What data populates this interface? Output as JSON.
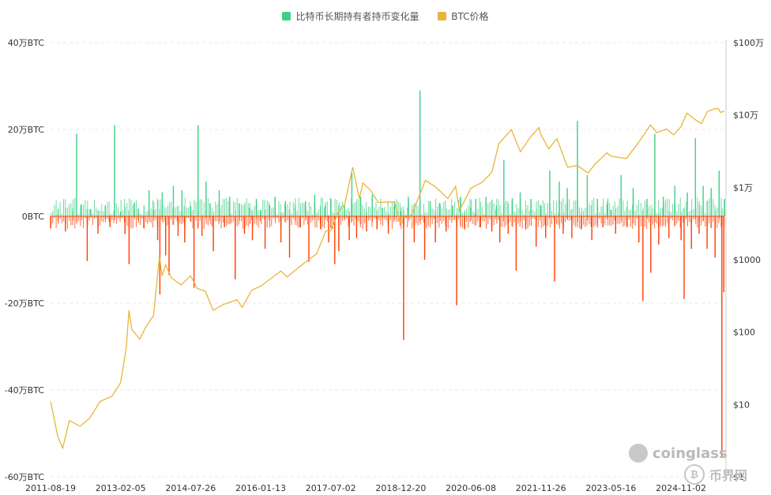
{
  "legend": {
    "lth_label": "比特币长期持有者持币变化量",
    "price_label": "BTC价格",
    "lth_pos_color": "#3fcf86",
    "lth_neg_color": "#ff3d00",
    "price_color": "#e8b53a"
  },
  "watermark": {
    "brand": "coinglass",
    "brand2": "币界网"
  },
  "chart_data": {
    "type": "bar",
    "left_axis": {
      "ticks": [
        "40万BTC",
        "20万BTC",
        "0BTC",
        "-20万BTC",
        "-40万BTC",
        "-60万BTC"
      ],
      "values": [
        400000,
        200000,
        0,
        -200000,
        -400000,
        -600000
      ],
      "ylim": [
        -600000,
        400000
      ]
    },
    "right_axis": {
      "scale": "log",
      "ticks": [
        "$100万",
        "$10万",
        "$1万",
        "$1000",
        "$100",
        "$10",
        "$1"
      ],
      "values": [
        1000000,
        100000,
        10000,
        1000,
        100,
        10,
        1
      ],
      "ylim": [
        1,
        1000000
      ]
    },
    "x_ticks": [
      "2011-08-19",
      "2013-02-05",
      "2014-07-26",
      "2016-01-13",
      "2017-07-02",
      "2018-12-20",
      "2020-06-08",
      "2021-11-26",
      "2023-05-16",
      "2024-11-02"
    ],
    "x_range": [
      "2011-08-19",
      "2025-09-30"
    ],
    "grid": true,
    "legend_position": "top-center",
    "series": [
      {
        "name": "BTC价格",
        "type": "line",
        "axis": "right",
        "points": [
          [
            "2011-08-19",
            11
          ],
          [
            "2011-10-15",
            3.5
          ],
          [
            "2011-11-20",
            2.5
          ],
          [
            "2012-01-10",
            6
          ],
          [
            "2012-04-01",
            5
          ],
          [
            "2012-06-15",
            6.5
          ],
          [
            "2012-09-01",
            11
          ],
          [
            "2012-12-01",
            13
          ],
          [
            "2013-02-05",
            20
          ],
          [
            "2013-03-20",
            60
          ],
          [
            "2013-04-10",
            200
          ],
          [
            "2013-05-01",
            110
          ],
          [
            "2013-07-01",
            80
          ],
          [
            "2013-08-20",
            120
          ],
          [
            "2013-10-15",
            170
          ],
          [
            "2013-11-29",
            1100
          ],
          [
            "2013-12-20",
            600
          ],
          [
            "2014-01-15",
            850
          ],
          [
            "2014-03-01",
            560
          ],
          [
            "2014-05-15",
            450
          ],
          [
            "2014-07-26",
            600
          ],
          [
            "2014-09-15",
            400
          ],
          [
            "2014-11-15",
            370
          ],
          [
            "2015-01-14",
            200
          ],
          [
            "2015-04-01",
            240
          ],
          [
            "2015-07-15",
            280
          ],
          [
            "2015-08-25",
            220
          ],
          [
            "2015-11-05",
            380
          ],
          [
            "2016-01-13",
            430
          ],
          [
            "2016-06-15",
            700
          ],
          [
            "2016-08-01",
            580
          ],
          [
            "2016-12-31",
            960
          ],
          [
            "2017-03-15",
            1200
          ],
          [
            "2017-05-25",
            2500
          ],
          [
            "2017-07-02",
            2500
          ],
          [
            "2017-09-01",
            4700
          ],
          [
            "2017-10-15",
            5700
          ],
          [
            "2017-12-17",
            19000
          ],
          [
            "2018-02-06",
            7000
          ],
          [
            "2018-03-05",
            11500
          ],
          [
            "2018-05-01",
            9200
          ],
          [
            "2018-06-30",
            6200
          ],
          [
            "2018-11-01",
            6300
          ],
          [
            "2018-12-15",
            3200
          ],
          [
            "2018-12-20",
            3900
          ],
          [
            "2019-03-01",
            3800
          ],
          [
            "2019-05-15",
            8000
          ],
          [
            "2019-06-26",
            12500
          ],
          [
            "2019-09-15",
            10000
          ],
          [
            "2019-12-15",
            7000
          ],
          [
            "2020-02-12",
            10300
          ],
          [
            "2020-03-13",
            4800
          ],
          [
            "2020-06-08",
            9700
          ],
          [
            "2020-09-01",
            11700
          ],
          [
            "2020-11-15",
            16000
          ],
          [
            "2021-01-08",
            40000
          ],
          [
            "2021-04-14",
            63000
          ],
          [
            "2021-06-22",
            31000
          ],
          [
            "2021-09-01",
            48000
          ],
          [
            "2021-11-10",
            67000
          ],
          [
            "2021-11-26",
            54000
          ],
          [
            "2022-01-24",
            34000
          ],
          [
            "2022-03-28",
            47000
          ],
          [
            "2022-06-18",
            19000
          ],
          [
            "2022-09-01",
            20000
          ],
          [
            "2022-11-21",
            15800
          ],
          [
            "2023-01-15",
            21000
          ],
          [
            "2023-04-14",
            30000
          ],
          [
            "2023-05-16",
            27000
          ],
          [
            "2023-09-11",
            25000
          ],
          [
            "2023-12-15",
            42000
          ],
          [
            "2024-03-14",
            73000
          ],
          [
            "2024-05-01",
            57000
          ],
          [
            "2024-07-15",
            64000
          ],
          [
            "2024-09-06",
            53000
          ],
          [
            "2024-11-02",
            69000
          ],
          [
            "2024-12-17",
            106000
          ],
          [
            "2025-02-27",
            84000
          ],
          [
            "2025-04-08",
            76000
          ],
          [
            "2025-05-22",
            111000
          ],
          [
            "2025-07-14",
            122000
          ],
          [
            "2025-08-14",
            123000
          ],
          [
            "2025-09-01",
            108000
          ],
          [
            "2025-09-30",
            114000
          ]
        ]
      },
      {
        "name": "比特币长期持有者持币变化量",
        "type": "bar",
        "axis": "left",
        "points": [
          [
            "2011-08-19",
            -28000
          ],
          [
            "2011-10-15",
            5000
          ],
          [
            "2011-12-10",
            -35000
          ],
          [
            "2012-02-05",
            12000
          ],
          [
            "2012-03-05",
            190000
          ],
          [
            "2012-04-10",
            28000
          ],
          [
            "2012-05-25",
            -103000
          ],
          [
            "2012-06-20",
            17000
          ],
          [
            "2012-08-15",
            -40000
          ],
          [
            "2012-10-10",
            25000
          ],
          [
            "2012-11-15",
            -25000
          ],
          [
            "2012-12-20",
            210000
          ],
          [
            "2013-02-05",
            11000
          ],
          [
            "2013-03-10",
            -41000
          ],
          [
            "2013-04-10",
            -110000
          ],
          [
            "2013-05-20",
            30000
          ],
          [
            "2013-06-20",
            18000
          ],
          [
            "2013-08-01",
            -27000
          ],
          [
            "2013-09-10",
            60000
          ],
          [
            "2013-10-15",
            15000
          ],
          [
            "2013-11-15",
            -55000
          ],
          [
            "2013-12-02",
            -180000
          ],
          [
            "2013-12-20",
            55000
          ],
          [
            "2014-01-15",
            -90000
          ],
          [
            "2014-02-10",
            -135000
          ],
          [
            "2014-03-15",
            70000
          ],
          [
            "2014-04-20",
            -45000
          ],
          [
            "2014-05-20",
            60000
          ],
          [
            "2014-06-10",
            -60000
          ],
          [
            "2014-07-26",
            24000
          ],
          [
            "2014-08-20",
            -165000
          ],
          [
            "2014-09-20",
            210000
          ],
          [
            "2014-10-20",
            -45000
          ],
          [
            "2014-11-20",
            80000
          ],
          [
            "2014-12-20",
            30000
          ],
          [
            "2015-01-15",
            -80000
          ],
          [
            "2015-03-01",
            60000
          ],
          [
            "2015-04-10",
            -25000
          ],
          [
            "2015-05-20",
            45000
          ],
          [
            "2015-07-01",
            -145000
          ],
          [
            "2015-08-01",
            30000
          ],
          [
            "2015-09-10",
            -40000
          ],
          [
            "2015-10-20",
            20000
          ],
          [
            "2015-11-10",
            -55000
          ],
          [
            "2015-12-10",
            40000
          ],
          [
            "2016-01-13",
            15000
          ],
          [
            "2016-02-15",
            -75000
          ],
          [
            "2016-03-20",
            25000
          ],
          [
            "2016-05-01",
            45000
          ],
          [
            "2016-06-15",
            -60000
          ],
          [
            "2016-07-20",
            35000
          ],
          [
            "2016-08-20",
            -95000
          ],
          [
            "2016-10-01",
            20000
          ],
          [
            "2016-11-10",
            -25000
          ],
          [
            "2016-12-20",
            35000
          ],
          [
            "2017-01-15",
            -105000
          ],
          [
            "2017-03-01",
            50000
          ],
          [
            "2017-04-15",
            -30000
          ],
          [
            "2017-05-20",
            25000
          ],
          [
            "2017-06-15",
            -60000
          ],
          [
            "2017-07-02",
            40000
          ],
          [
            "2017-08-01",
            -110000
          ],
          [
            "2017-09-01",
            -80000
          ],
          [
            "2017-10-15",
            25000
          ],
          [
            "2017-11-20",
            -55000
          ],
          [
            "2017-12-10",
            100000
          ],
          [
            "2018-01-15",
            -50000
          ],
          [
            "2018-02-15",
            45000
          ],
          [
            "2018-04-01",
            -35000
          ],
          [
            "2018-05-15",
            50000
          ],
          [
            "2018-06-20",
            -30000
          ],
          [
            "2018-08-01",
            20000
          ],
          [
            "2018-09-15",
            -40000
          ],
          [
            "2018-11-01",
            35000
          ],
          [
            "2018-12-20",
            12000
          ],
          [
            "2019-01-10",
            -285000
          ],
          [
            "2019-02-15",
            45000
          ],
          [
            "2019-04-01",
            -60000
          ],
          [
            "2019-05-15",
            290000
          ],
          [
            "2019-06-20",
            -100000
          ],
          [
            "2019-08-01",
            35000
          ],
          [
            "2019-09-10",
            -60000
          ],
          [
            "2019-10-15",
            30000
          ],
          [
            "2019-12-01",
            -35000
          ],
          [
            "2020-01-20",
            25000
          ],
          [
            "2020-02-20",
            -205000
          ],
          [
            "2020-03-20",
            45000
          ],
          [
            "2020-04-20",
            -30000
          ],
          [
            "2020-06-08",
            20000
          ],
          [
            "2020-07-15",
            40000
          ],
          [
            "2020-08-20",
            -25000
          ],
          [
            "2020-10-01",
            45000
          ],
          [
            "2020-11-15",
            -35000
          ],
          [
            "2020-12-20",
            25000
          ],
          [
            "2021-01-15",
            -60000
          ],
          [
            "2021-02-15",
            130000
          ],
          [
            "2021-03-20",
            -40000
          ],
          [
            "2021-04-20",
            40000
          ],
          [
            "2021-05-20",
            -125000
          ],
          [
            "2021-06-20",
            55000
          ],
          [
            "2021-08-01",
            -30000
          ],
          [
            "2021-09-10",
            40000
          ],
          [
            "2021-10-20",
            -70000
          ],
          [
            "2021-11-26",
            25000
          ],
          [
            "2022-01-01",
            -50000
          ],
          [
            "2022-02-01",
            105000
          ],
          [
            "2022-03-10",
            -150000
          ],
          [
            "2022-04-15",
            80000
          ],
          [
            "2022-05-15",
            -40000
          ],
          [
            "2022-06-15",
            65000
          ],
          [
            "2022-07-20",
            -50000
          ],
          [
            "2022-09-01",
            220000
          ],
          [
            "2022-10-01",
            -30000
          ],
          [
            "2022-11-15",
            95000
          ],
          [
            "2022-12-20",
            -55000
          ],
          [
            "2023-02-01",
            40000
          ],
          [
            "2023-03-15",
            -25000
          ],
          [
            "2023-04-20",
            35000
          ],
          [
            "2023-05-16",
            15000
          ],
          [
            "2023-06-20",
            -40000
          ],
          [
            "2023-08-01",
            95000
          ],
          [
            "2023-09-15",
            -25000
          ],
          [
            "2023-11-01",
            65000
          ],
          [
            "2023-12-15",
            -60000
          ],
          [
            "2024-01-15",
            -195000
          ],
          [
            "2024-02-15",
            40000
          ],
          [
            "2024-03-15",
            -130000
          ],
          [
            "2024-04-15",
            190000
          ],
          [
            "2024-05-15",
            -65000
          ],
          [
            "2024-06-20",
            45000
          ],
          [
            "2024-08-01",
            -50000
          ],
          [
            "2024-09-15",
            70000
          ],
          [
            "2024-11-02",
            -55000
          ],
          [
            "2024-11-25",
            -190000
          ],
          [
            "2024-12-20",
            55000
          ],
          [
            "2025-01-20",
            -75000
          ],
          [
            "2025-02-20",
            180000
          ],
          [
            "2025-03-20",
            -40000
          ],
          [
            "2025-04-20",
            70000
          ],
          [
            "2025-05-20",
            -75000
          ],
          [
            "2025-06-20",
            65000
          ],
          [
            "2025-07-20",
            -95000
          ],
          [
            "2025-08-20",
            105000
          ],
          [
            "2025-09-10",
            -555000
          ],
          [
            "2025-09-25",
            -175000
          ],
          [
            "2025-09-30",
            40000
          ]
        ]
      }
    ]
  }
}
